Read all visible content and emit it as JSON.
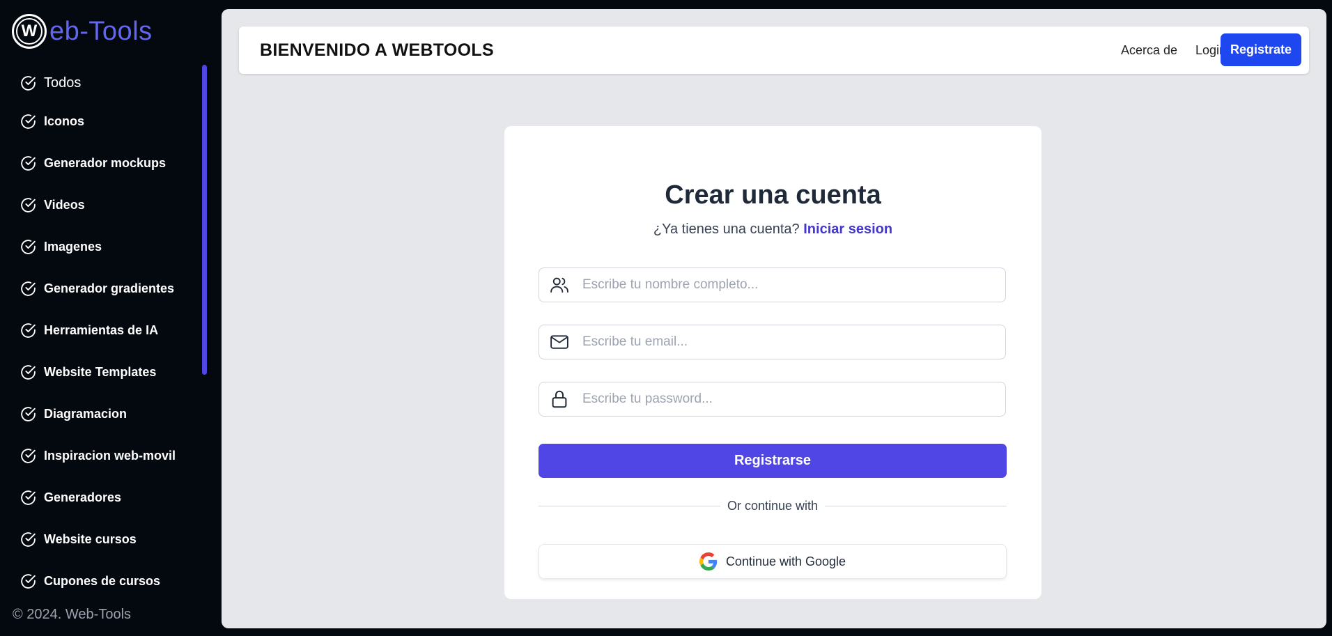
{
  "sidebar": {
    "logo_mark": "W",
    "logo_text": "eb-Tools",
    "items": [
      {
        "label": "Todos",
        "icon": "check-circle-icon"
      },
      {
        "label": "Iconos",
        "icon": "check-circle-icon"
      },
      {
        "label": "Generador mockups",
        "icon": "check-circle-icon"
      },
      {
        "label": "Videos",
        "icon": "check-circle-icon"
      },
      {
        "label": "Imagenes",
        "icon": "check-circle-icon"
      },
      {
        "label": "Generador gradientes",
        "icon": "check-circle-icon"
      },
      {
        "label": "Herramientas de IA",
        "icon": "check-circle-icon"
      },
      {
        "label": "Website Templates",
        "icon": "check-circle-icon"
      },
      {
        "label": "Diagramacion",
        "icon": "check-circle-icon"
      },
      {
        "label": "Inspiracion web-movil",
        "icon": "check-circle-icon"
      },
      {
        "label": "Generadores",
        "icon": "check-circle-icon"
      },
      {
        "label": "Website cursos",
        "icon": "check-circle-icon"
      },
      {
        "label": "Cupones de cursos",
        "icon": "check-circle-icon"
      }
    ],
    "copyright": "© 2024. Web-Tools"
  },
  "header": {
    "title": "BIENVENIDO A WEBTOOLS",
    "about_label": "Acerca de",
    "login_label": "Login",
    "register_label": "Registrate"
  },
  "form": {
    "title": "Crear una cuenta",
    "subtitle": "¿Ya tienes una cuenta?",
    "signin_link": "Iniciar sesion",
    "name_placeholder": "Escribe tu nombre completo...",
    "email_placeholder": "Escribe tu email...",
    "password_placeholder": "Escribe tu password...",
    "submit_label": "Registrarse",
    "divider_text": "Or continue with",
    "google_label": "Continue with Google"
  },
  "colors": {
    "accent": "#4f46e5",
    "brand_blue": "#1f47f0",
    "sidebar_bg": "#04080f",
    "main_bg": "#e5e7eb"
  }
}
